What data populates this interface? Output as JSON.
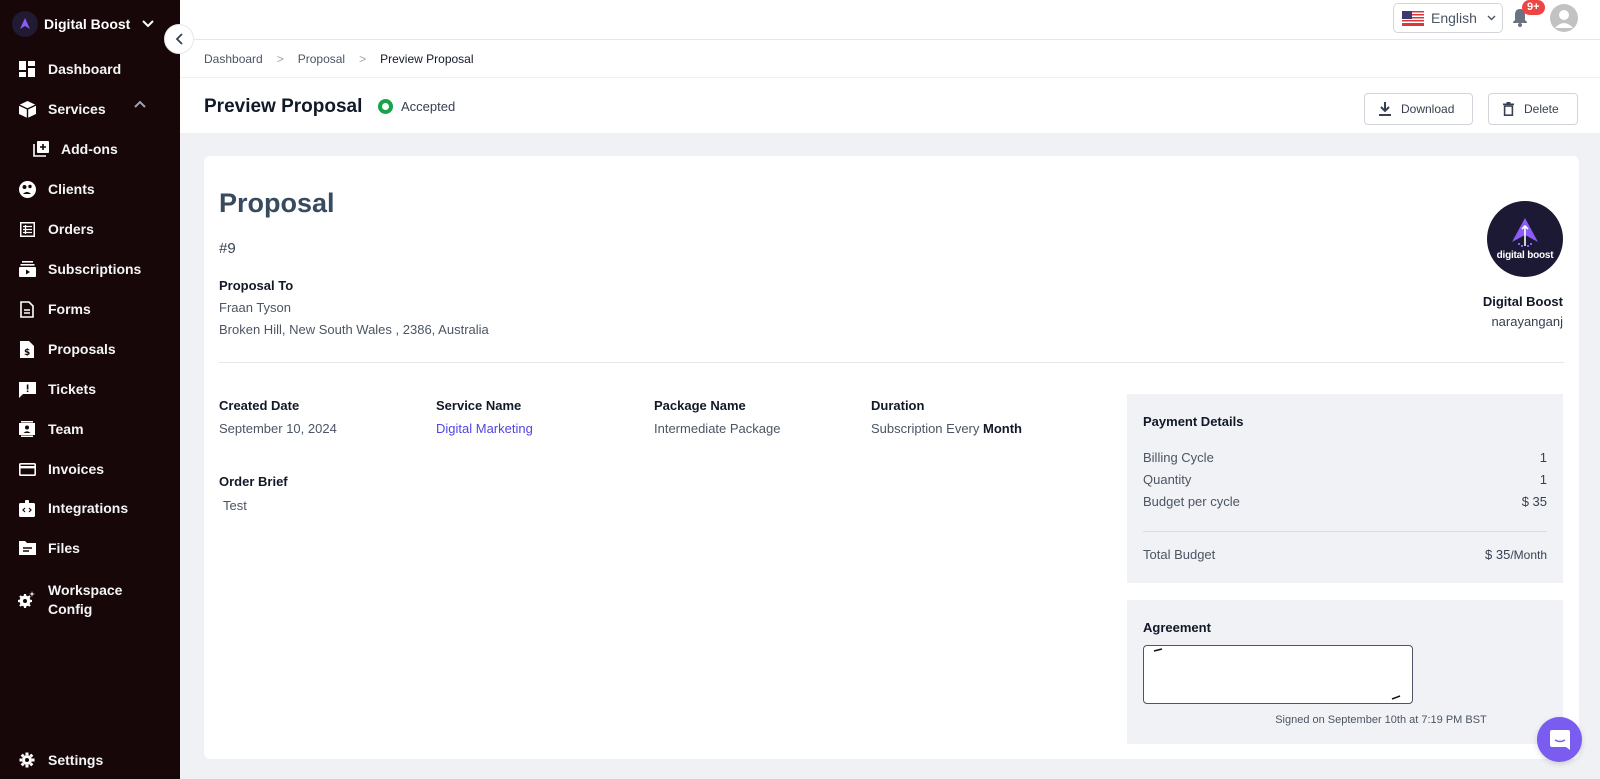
{
  "brand": {
    "name": "Digital Boost",
    "logo_text": "digital boost"
  },
  "sidebar": {
    "items": [
      {
        "label": "Dashboard",
        "icon": "dashboard-icon"
      },
      {
        "label": "Services",
        "icon": "package-icon",
        "expanded": true
      },
      {
        "label": "Add-ons",
        "icon": "add-box-icon",
        "sub": true
      },
      {
        "label": "Clients",
        "icon": "clients-icon"
      },
      {
        "label": "Orders",
        "icon": "orders-icon"
      },
      {
        "label": "Subscriptions",
        "icon": "subscriptions-icon"
      },
      {
        "label": "Forms",
        "icon": "forms-icon"
      },
      {
        "label": "Proposals",
        "icon": "proposals-icon"
      },
      {
        "label": "Tickets",
        "icon": "tickets-icon"
      },
      {
        "label": "Team",
        "icon": "team-icon"
      },
      {
        "label": "Invoices",
        "icon": "invoices-icon"
      },
      {
        "label": "Integrations",
        "icon": "integrations-icon"
      },
      {
        "label": "Files",
        "icon": "files-icon"
      },
      {
        "label": "Workspace Config",
        "icon": "workspace-config-icon"
      }
    ],
    "settings_label": "Settings"
  },
  "topbar": {
    "language": "English",
    "notification_badge": "9+"
  },
  "breadcrumb": [
    "Dashboard",
    "Proposal",
    "Preview Proposal"
  ],
  "header": {
    "title": "Preview Proposal",
    "status": "Accepted",
    "status_color": "#16a34a",
    "download_label": "Download",
    "delete_label": "Delete"
  },
  "proposal": {
    "title": "Proposal",
    "number": "#9",
    "to_label": "Proposal To",
    "to_name": "Fraan Tyson",
    "to_address": "Broken Hill, New South Wales , 2386, Australia",
    "company_name": "Digital Boost",
    "company_location": "narayanganj",
    "fields": [
      {
        "label": "Created Date",
        "value": "September 10, 2024"
      },
      {
        "label": "Service Name",
        "value": "Digital Marketing"
      },
      {
        "label": "Package Name",
        "value": "Intermediate Package"
      },
      {
        "label": "Duration",
        "value_prefix": "Subscription Every",
        "value_emph": "Month"
      }
    ],
    "brief_label": "Order Brief",
    "brief_value": "Test"
  },
  "payment": {
    "title": "Payment Details",
    "rows": [
      {
        "label": "Billing Cycle",
        "value": "1"
      },
      {
        "label": "Quantity",
        "value": "1"
      },
      {
        "label": "Budget per cycle",
        "value": "$ 35"
      }
    ],
    "total_label": "Total Budget",
    "total_value": "$ 35",
    "total_unit": "/Month"
  },
  "agreement": {
    "title": "Agreement",
    "signed_text": "Signed on September 10th at 7:19 PM BST"
  },
  "colors": {
    "sidebar_bg": "#170708",
    "accent": "#7b5cf0",
    "link": "#4f46e5",
    "badge": "#ef4444"
  }
}
